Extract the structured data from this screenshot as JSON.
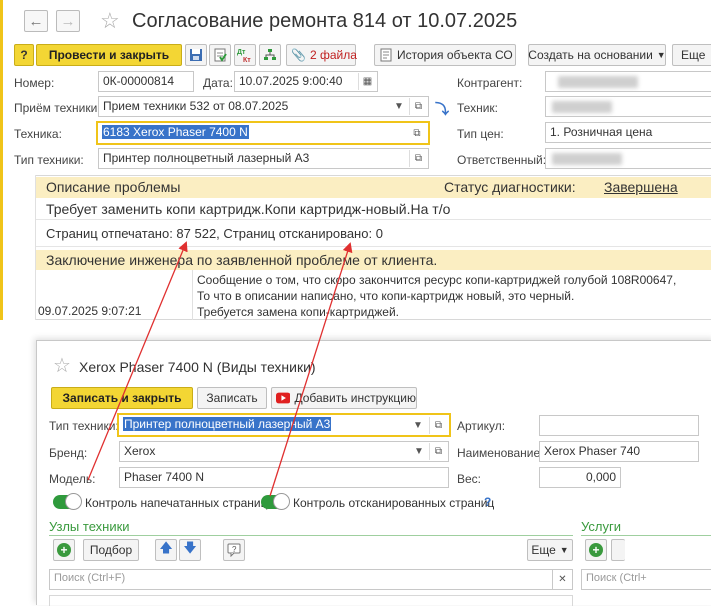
{
  "main": {
    "title": "Согласование ремонта 814 от 10.07.2025",
    "toolbar": {
      "post_close": "Провести и закрыть",
      "files": "2 файла",
      "history": "История объекта СО",
      "create_based": "Создать на основании",
      "more": "Еще"
    },
    "form": {
      "number_label": "Номер:",
      "number_value": "0К-00000814",
      "date_label": "Дата:",
      "date_value": "10.07.2025  9:00:40",
      "counterparty_label": "Контрагент:",
      "intake_label": "Приём техники:",
      "intake_value": "Прием техники 532 от 08.07.2025",
      "technician_label": "Техник:",
      "equipment_label": "Техника:",
      "equipment_value": "6183 Xerox Phaser 7400 N",
      "price_type_label": "Тип цен:",
      "price_type_value": "1. Розничная цена",
      "eq_type_label": "Тип техники:",
      "eq_type_value": "Принтер полноцветный лазерный А3",
      "responsible_label": "Ответственный:"
    },
    "problem": {
      "heading": "Описание проблемы",
      "status_label": "Статус диагностики:",
      "status_value": "Завершена",
      "description": "Требует заменить копи картридж.Копи картридж-новый.На т/о",
      "counters": "Страниц отпечатано: 87 522, Страниц отсканировано: 0"
    },
    "conclusion": {
      "heading": "Заключение инженера по заявленной проблеме от клиента.",
      "date": "09.07.2025 9:07:21",
      "lines": [
        "Сообщение о том, что скоро закончится ресурс копи-картриджей голубой 108R00647,",
        "То что в описании написано, что копи-картридж новый, это черный.",
        "Требуется замена копи-картриджей."
      ]
    }
  },
  "dialog": {
    "title": "Xerox Phaser 7400 N (Виды техники)",
    "toolbar": {
      "save_close": "Записать и закрыть",
      "save": "Записать",
      "add_instruction": "Добавить инструкцию"
    },
    "form": {
      "eq_type_label": "Тип техники:",
      "eq_type_value": "Принтер полноцветный лазерный А3",
      "article_label": "Артикул:",
      "brand_label": "Бренд:",
      "brand_value": "Xerox",
      "name_label": "Наименование:",
      "name_value": "Xerox Phaser 740",
      "model_label": "Модель:",
      "model_value": "Phaser 7400 N",
      "weight_label": "Вес:",
      "weight_value": "0,000"
    },
    "toggles": {
      "printed_label": "Контроль напечатанных страниц",
      "scanned_label": "Контроль отсканированных страниц",
      "help": "?"
    },
    "nodes": {
      "heading": "Узлы техники",
      "pick": "Подбор",
      "more": "Еще",
      "search_placeholder": "Поиск (Ctrl+F)"
    },
    "services": {
      "heading": "Услуги",
      "search_placeholder": "Поиск (Ctrl+"
    }
  },
  "colors": {
    "accent_yellow": "#f3d634",
    "band": "#fbeec2",
    "focus_border": "#f0c419",
    "selection": "#3873c9",
    "link_green": "#3a9a3e",
    "arrow_red": "#e03030"
  }
}
